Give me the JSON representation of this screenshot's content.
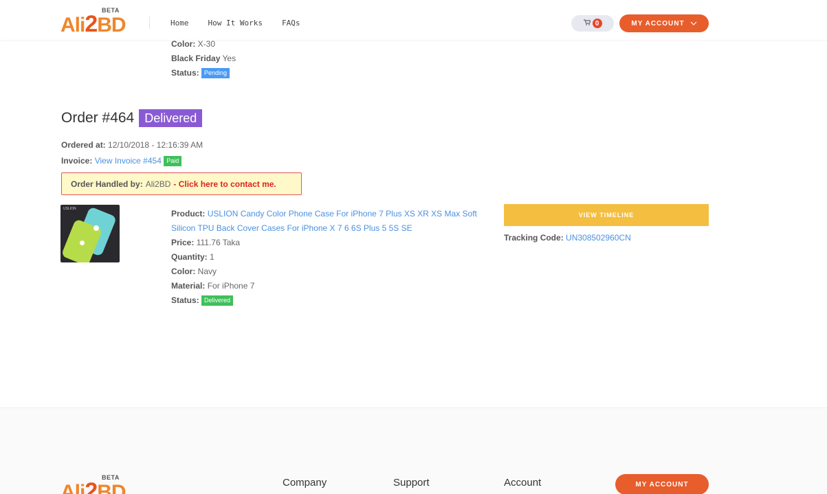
{
  "header": {
    "logo_main": "Ali",
    "logo_two": "2",
    "logo_end": "BD",
    "logo_beta": "BETA",
    "nav": [
      "Home",
      "How It Works",
      "FAQs"
    ],
    "cart_count": "0",
    "account_label": "MY ACCOUNT"
  },
  "prev_order": {
    "color_label": "Color:",
    "color_value": "X-30",
    "bf_label": "Black Friday",
    "bf_value": "Yes",
    "status_label": "Status:",
    "status_value": "Pending"
  },
  "order": {
    "title": "Order #464",
    "status": "Delivered",
    "ordered_label": "Ordered at:",
    "ordered_value": "12/10/2018 - 12:16:39 AM",
    "invoice_label": "Invoice:",
    "invoice_link": "View Invoice #454",
    "invoice_badge": "Paid",
    "handler_label": "Order Handled by:",
    "handler_name": "Ali2BD",
    "handler_contact": "- Click here to contact me.",
    "thumb_brand": "USLION"
  },
  "product": {
    "product_label": "Product:",
    "product_name": "USLION Candy Color Phone Case For iPhone 7 Plus XS XR XS Max Soft Silicon TPU Back Cover Cases For iPhone X 7 6 6S Plus 5 5S SE",
    "price_label": "Price:",
    "price_value": "111.76 Taka",
    "qty_label": "Quantity:",
    "qty_value": "1",
    "color_label": "Color:",
    "color_value": "Navy",
    "material_label": "Material:",
    "material_value": "For iPhone 7",
    "status_label": "Status:",
    "status_value": "Delivered",
    "timeline_label": "VIEW TIMELINE",
    "tracking_label": "Tracking Code:",
    "tracking_value": "UN308502960CN"
  },
  "footer": {
    "col_company": "Company",
    "col_support": "Support",
    "col_account": "Account",
    "account_btn": "MY ACCOUNT"
  },
  "colors": {
    "brand_orange": "#e85d2c",
    "delivered_purple": "#8a5ad4",
    "timeline_yellow": "#f4be41",
    "link_blue": "#4a90e2"
  }
}
